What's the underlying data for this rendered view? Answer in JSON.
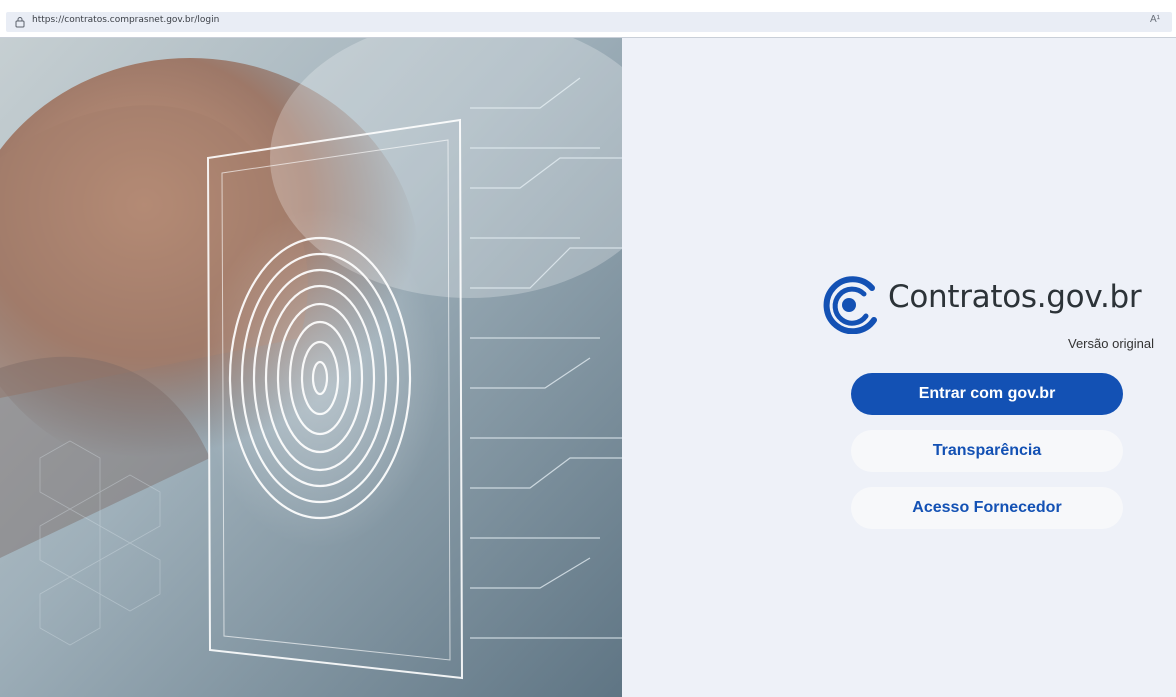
{
  "browser": {
    "url": "https://contratos.comprasnet.gov.br/login",
    "read_aloud_icon": "A¹"
  },
  "hero": {
    "image": "fingerprint-scan-illustration"
  },
  "login": {
    "brand": "Contratos.gov.br",
    "version": "Versão original",
    "buttons": {
      "govbr": "Entrar com gov.br",
      "transparencia": "Transparência",
      "fornecedor": "Acesso Fornecedor"
    }
  },
  "colors": {
    "primary": "#1351b4",
    "panel_bg": "#eef1f8",
    "logo_blue": "#1351b4"
  }
}
